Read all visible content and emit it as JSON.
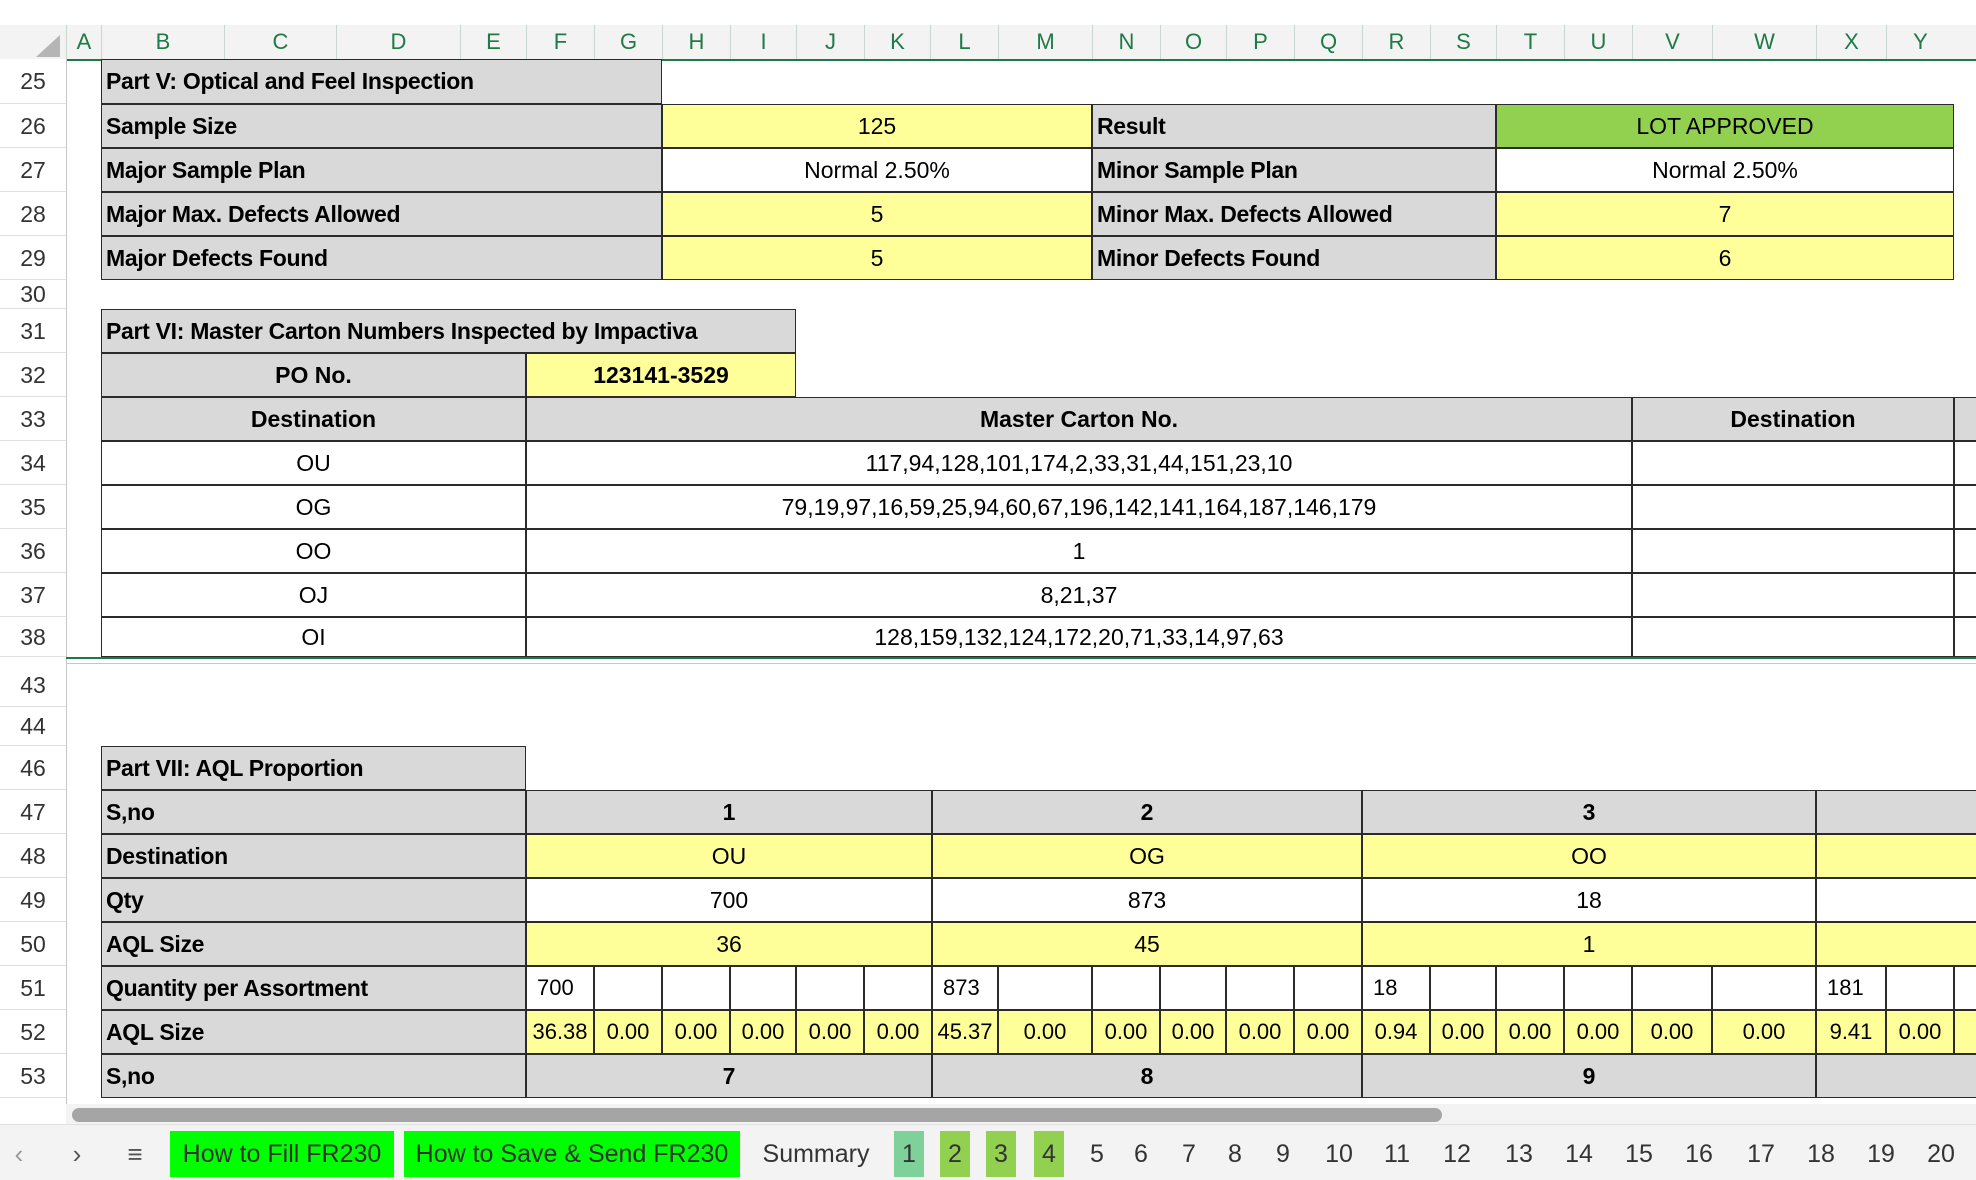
{
  "columns": [
    "A",
    "B",
    "C",
    "D",
    "E",
    "F",
    "G",
    "H",
    "I",
    "J",
    "K",
    "L",
    "M",
    "N",
    "O",
    "P",
    "Q",
    "R",
    "S",
    "T",
    "U",
    "V",
    "W",
    "X",
    "Y"
  ],
  "rows": [
    "25",
    "26",
    "27",
    "28",
    "29",
    "30",
    "31",
    "32",
    "33",
    "34",
    "35",
    "36",
    "37",
    "38",
    "43",
    "44",
    "46",
    "47",
    "48",
    "49",
    "50",
    "51",
    "52",
    "53"
  ],
  "part5": {
    "title": "Part V: Optical and Feel Inspection",
    "sample_size_label": "Sample Size",
    "sample_size": "125",
    "result_label": "Result",
    "result": "LOT APPROVED",
    "major_plan_label": "Major Sample Plan",
    "major_plan": "Normal 2.50%",
    "minor_plan_label": "Minor Sample Plan",
    "minor_plan": "Normal 2.50%",
    "major_max_label": "Major Max. Defects Allowed",
    "major_max": "5",
    "minor_max_label": "Minor Max. Defects Allowed",
    "minor_max": "7",
    "major_found_label": "Major Defects Found",
    "major_found": "5",
    "minor_found_label": "Minor Defects Found",
    "minor_found": "6",
    "result_color": "#92d050"
  },
  "part6": {
    "title": "Part VI: Master Carton Numbers Inspected by Impactiva",
    "po_label": "PO No.",
    "po_value": "123141-3529",
    "dest_header": "Destination",
    "carton_header": "Master Carton No.",
    "dest_header2": "Destination",
    "rows": [
      {
        "dest": "OU",
        "cartons": "117,94,128,101,174,2,33,31,44,151,23,10"
      },
      {
        "dest": "OG",
        "cartons": "79,19,97,16,59,25,94,60,67,196,142,141,164,187,146,179"
      },
      {
        "dest": "OO",
        "cartons": "1"
      },
      {
        "dest": "OJ",
        "cartons": "8,21,37"
      },
      {
        "dest": "OI",
        "cartons": "128,159,132,124,172,20,71,33,14,97,63"
      }
    ]
  },
  "part7": {
    "title": "Part VII: AQL Proportion",
    "sno_label": "S,no",
    "dest_label": "Destination",
    "qty_label": "Qty",
    "aql_size_label": "AQL Size",
    "qpa_label": "Quantity per Assortment",
    "aql_size_label2": "AQL Size",
    "sno_label2": "S,no",
    "groups": [
      {
        "sno": "1",
        "dest": "OU",
        "qty": "700",
        "aql": "36",
        "sno2": "7"
      },
      {
        "sno": "2",
        "dest": "OG",
        "qty": "873",
        "aql": "45",
        "sno2": "8"
      },
      {
        "sno": "3",
        "dest": "OO",
        "qty": "18",
        "aql": "1",
        "sno2": "9"
      }
    ],
    "qpa": [
      "700",
      "",
      "",
      "",
      "",
      "",
      "873",
      "",
      "",
      "",
      "",
      "",
      "18",
      "",
      "",
      "",
      "",
      "",
      "181",
      ""
    ],
    "aql_values": [
      "36.38",
      "0.00",
      "0.00",
      "0.00",
      "0.00",
      "0.00",
      "45.37",
      "0.00",
      "0.00",
      "0.00",
      "0.00",
      "0.00",
      "0.94",
      "0.00",
      "0.00",
      "0.00",
      "0.00",
      "0.00",
      "9.41",
      "0.00"
    ]
  },
  "tabs": {
    "prev": "‹",
    "next": "›",
    "menu": "≡",
    "how_fill": "How to Fill FR230",
    "how_save": "How to Save & Send FR230",
    "summary": "Summary",
    "numbers": [
      "1",
      "2",
      "3",
      "4",
      "5",
      "6",
      "7",
      "8",
      "9",
      "10",
      "11",
      "12",
      "13",
      "14",
      "15",
      "16",
      "17",
      "18",
      "19",
      "20"
    ],
    "highlight_color": "#00ff00"
  }
}
